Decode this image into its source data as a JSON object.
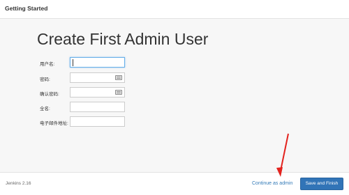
{
  "header": {
    "title": "Getting Started"
  },
  "main": {
    "title": "Create First Admin User",
    "fields": [
      {
        "label": "用户名:",
        "value": ""
      },
      {
        "label": "密码:",
        "value": ""
      },
      {
        "label": "确认密码:",
        "value": ""
      },
      {
        "label": "全名:",
        "value": ""
      },
      {
        "label": "电子邮件地址:",
        "value": ""
      }
    ]
  },
  "footer": {
    "version": "Jenkins 2.16",
    "continue_label": "Continue as admin",
    "save_label": "Save and Finish"
  },
  "colors": {
    "accent": "#3174b7",
    "annotation": "#e3231e"
  },
  "icons": {
    "password_field_icon": "key-icon"
  }
}
